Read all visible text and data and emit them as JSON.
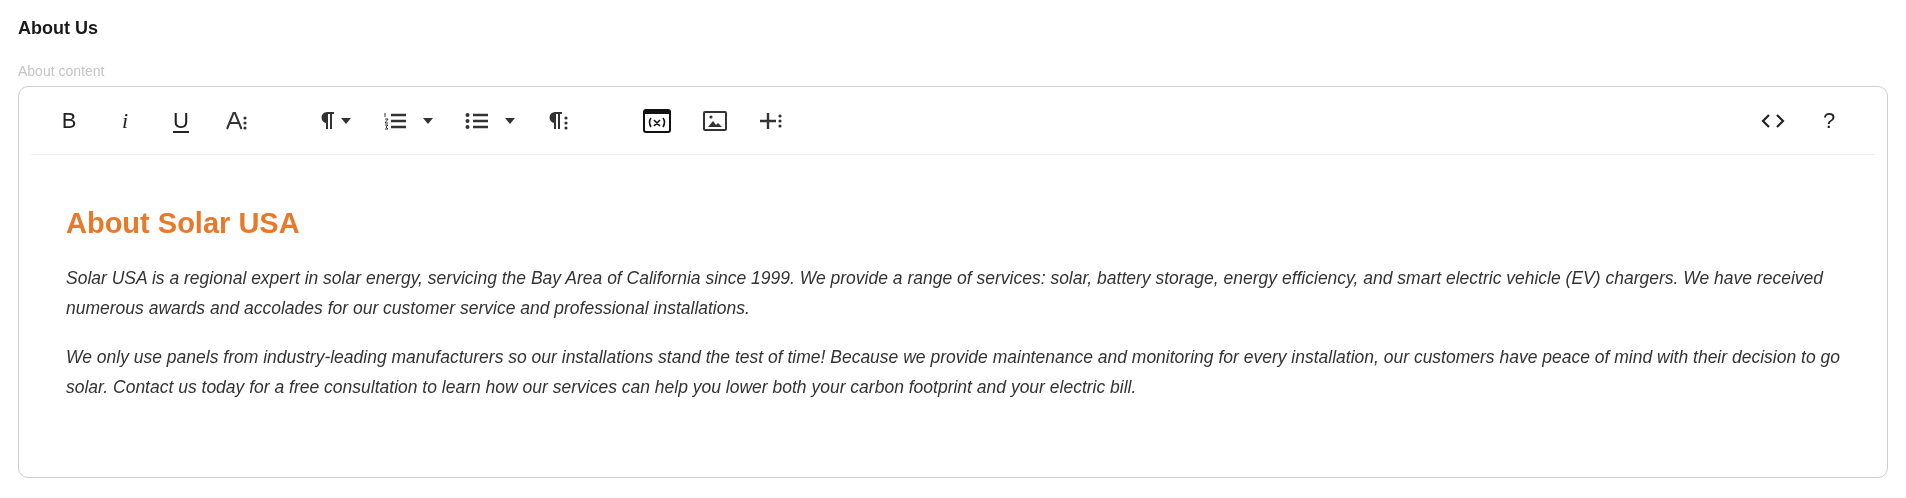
{
  "section_title": "About Us",
  "field_label": "About content",
  "toolbar": {
    "left_groups": [
      [
        {
          "kind": "bold",
          "label": "B"
        },
        {
          "kind": "italic",
          "label": "i"
        },
        {
          "kind": "underline",
          "label": "U"
        },
        {
          "kind": "font-size"
        }
      ],
      [
        {
          "kind": "paragraph-menu"
        },
        {
          "kind": "ordered-list-menu"
        },
        {
          "kind": "bullet-list-menu"
        },
        {
          "kind": "paragraph-options"
        }
      ],
      [
        {
          "kind": "variable"
        },
        {
          "kind": "image"
        },
        {
          "kind": "insert"
        }
      ]
    ],
    "right": [
      {
        "kind": "code"
      },
      {
        "kind": "help",
        "label": "?"
      }
    ]
  },
  "content": {
    "heading": "About Solar USA",
    "paragraphs": [
      "Solar USA is a regional expert in solar energy, servicing the Bay Area of California since 1999. We provide a range of services: solar, battery storage, energy efficiency, and smart electric vehicle (EV) chargers. We have received numerous awards and accolades for our customer service and professional installations.",
      "We only use panels from industry-leading manufacturers so our installations stand the test of time! Because we provide maintenance and monitoring for every installation, our customers have peace of mind with their decision to go solar. Contact us today for a free consultation to learn how our services can help you lower both your carbon footprint and your electric bill."
    ]
  }
}
